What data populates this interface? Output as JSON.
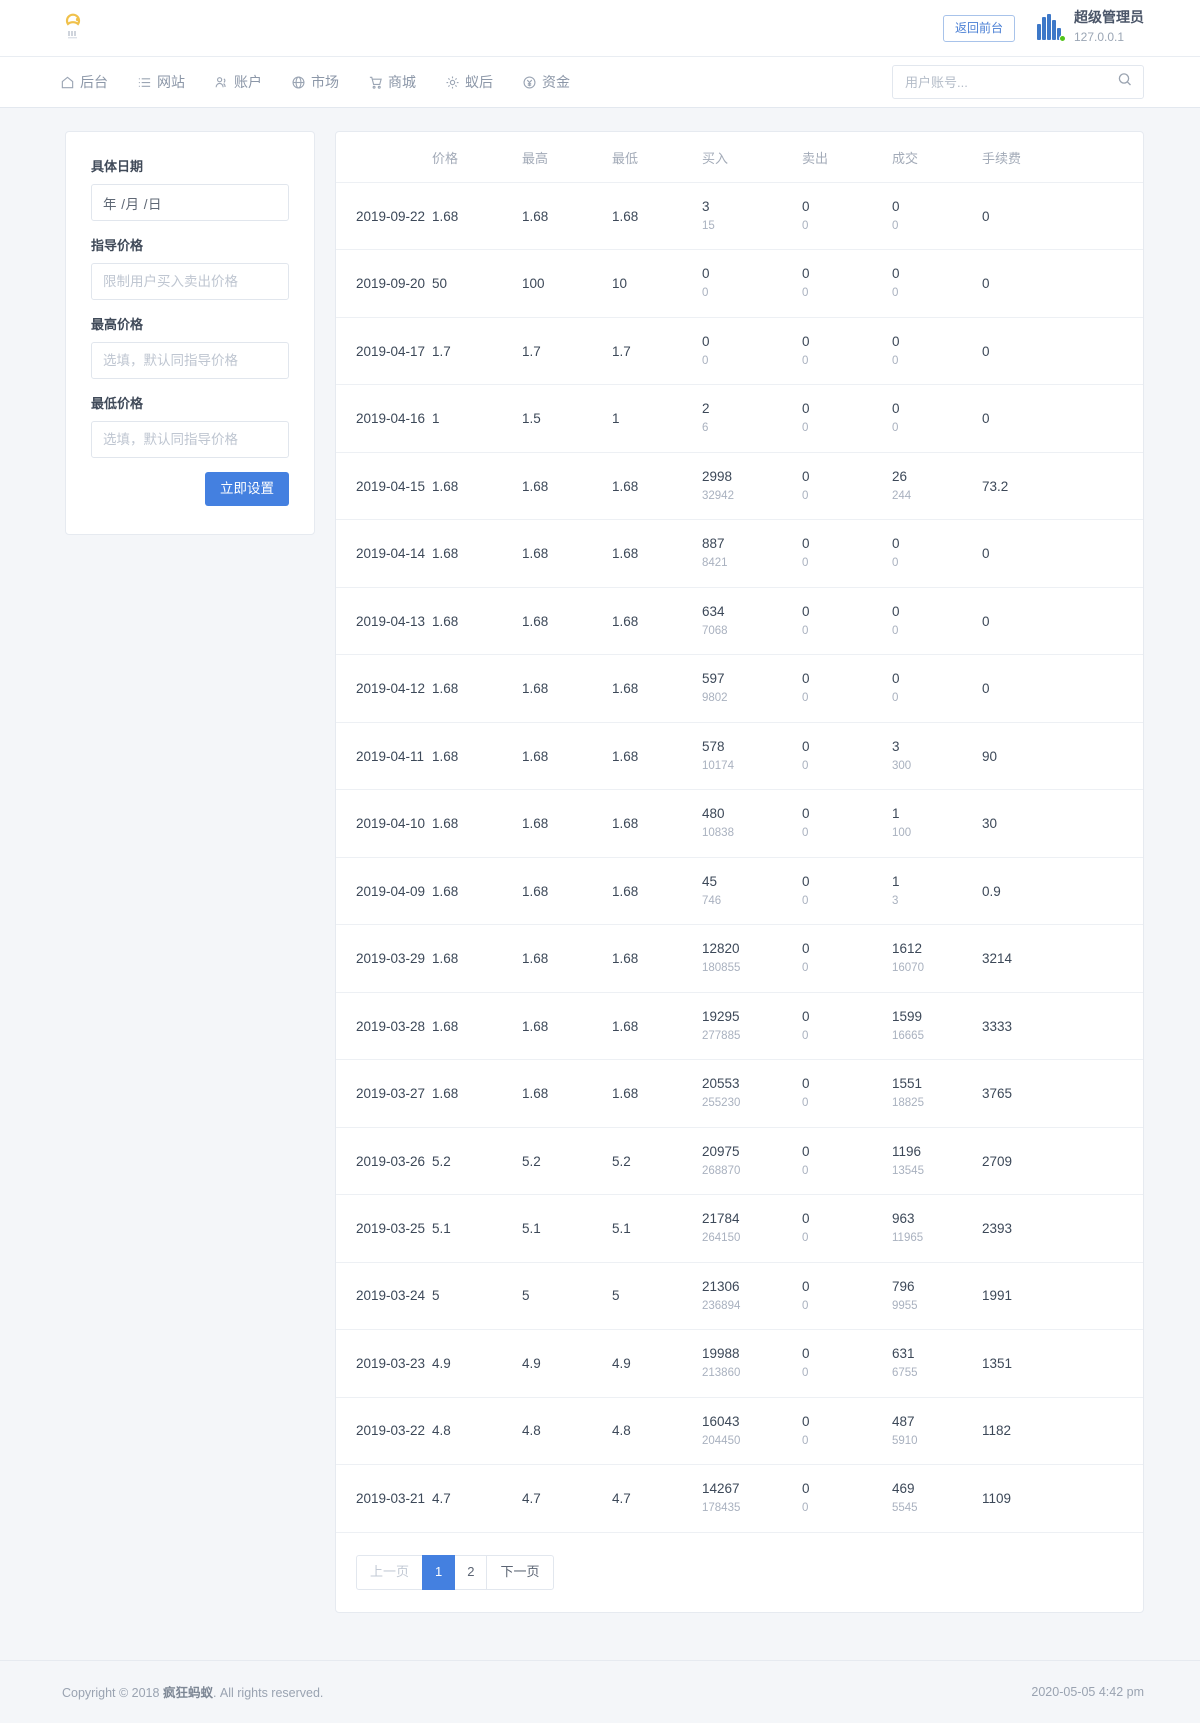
{
  "topbar": {
    "logo_icon": "ant-logo-icon",
    "return_front_label": "返回前台",
    "admin_name": "超级管理员",
    "admin_ip": "127.0.0.1"
  },
  "nav": {
    "items": [
      {
        "label": "后台",
        "icon": "home-icon"
      },
      {
        "label": "网站",
        "icon": "list-icon"
      },
      {
        "label": "账户",
        "icon": "users-icon"
      },
      {
        "label": "市场",
        "icon": "globe-icon"
      },
      {
        "label": "商城",
        "icon": "cart-icon"
      },
      {
        "label": "蚁后",
        "icon": "gear-icon"
      },
      {
        "label": "资金",
        "icon": "coin-icon"
      }
    ],
    "search_placeholder": "用户账号...",
    "search_value": "",
    "search_icon": "search-icon"
  },
  "form": {
    "fields": [
      {
        "label": "具体日期",
        "value": "年 /月 /日",
        "placeholder": "年 /月 /日",
        "name": "date-field"
      },
      {
        "label": "指导价格",
        "value": "",
        "placeholder": "限制用户买入卖出价格",
        "name": "guide-price-field"
      },
      {
        "label": "最高价格",
        "value": "",
        "placeholder": "选填，默认同指导价格",
        "name": "max-price-field"
      },
      {
        "label": "最低价格",
        "value": "",
        "placeholder": "选填，默认同指导价格",
        "name": "min-price-field"
      }
    ],
    "submit_label": "立即设置"
  },
  "table": {
    "columns": [
      "",
      "价格",
      "最高",
      "最低",
      "买入",
      "卖出",
      "成交",
      "手续费"
    ],
    "rows": [
      {
        "date": "2019-09-22",
        "price": "1.68",
        "high": "1.68",
        "low": "1.68",
        "buy": "3",
        "buy_sub": "15",
        "sell": "0",
        "sell_sub": "0",
        "deal": "0",
        "deal_sub": "0",
        "fee": "0"
      },
      {
        "date": "2019-09-20",
        "price": "50",
        "high": "100",
        "low": "10",
        "buy": "0",
        "buy_sub": "0",
        "sell": "0",
        "sell_sub": "0",
        "deal": "0",
        "deal_sub": "0",
        "fee": "0"
      },
      {
        "date": "2019-04-17",
        "price": "1.7",
        "high": "1.7",
        "low": "1.7",
        "buy": "0",
        "buy_sub": "0",
        "sell": "0",
        "sell_sub": "0",
        "deal": "0",
        "deal_sub": "0",
        "fee": "0"
      },
      {
        "date": "2019-04-16",
        "price": "1",
        "high": "1.5",
        "low": "1",
        "buy": "2",
        "buy_sub": "6",
        "sell": "0",
        "sell_sub": "0",
        "deal": "0",
        "deal_sub": "0",
        "fee": "0"
      },
      {
        "date": "2019-04-15",
        "price": "1.68",
        "high": "1.68",
        "low": "1.68",
        "buy": "2998",
        "buy_sub": "32942",
        "sell": "0",
        "sell_sub": "0",
        "deal": "26",
        "deal_sub": "244",
        "fee": "73.2"
      },
      {
        "date": "2019-04-14",
        "price": "1.68",
        "high": "1.68",
        "low": "1.68",
        "buy": "887",
        "buy_sub": "8421",
        "sell": "0",
        "sell_sub": "0",
        "deal": "0",
        "deal_sub": "0",
        "fee": "0"
      },
      {
        "date": "2019-04-13",
        "price": "1.68",
        "high": "1.68",
        "low": "1.68",
        "buy": "634",
        "buy_sub": "7068",
        "sell": "0",
        "sell_sub": "0",
        "deal": "0",
        "deal_sub": "0",
        "fee": "0"
      },
      {
        "date": "2019-04-12",
        "price": "1.68",
        "high": "1.68",
        "low": "1.68",
        "buy": "597",
        "buy_sub": "9802",
        "sell": "0",
        "sell_sub": "0",
        "deal": "0",
        "deal_sub": "0",
        "fee": "0"
      },
      {
        "date": "2019-04-11",
        "price": "1.68",
        "high": "1.68",
        "low": "1.68",
        "buy": "578",
        "buy_sub": "10174",
        "sell": "0",
        "sell_sub": "0",
        "deal": "3",
        "deal_sub": "300",
        "fee": "90"
      },
      {
        "date": "2019-04-10",
        "price": "1.68",
        "high": "1.68",
        "low": "1.68",
        "buy": "480",
        "buy_sub": "10838",
        "sell": "0",
        "sell_sub": "0",
        "deal": "1",
        "deal_sub": "100",
        "fee": "30"
      },
      {
        "date": "2019-04-09",
        "price": "1.68",
        "high": "1.68",
        "low": "1.68",
        "buy": "45",
        "buy_sub": "746",
        "sell": "0",
        "sell_sub": "0",
        "deal": "1",
        "deal_sub": "3",
        "fee": "0.9"
      },
      {
        "date": "2019-03-29",
        "price": "1.68",
        "high": "1.68",
        "low": "1.68",
        "buy": "12820",
        "buy_sub": "180855",
        "sell": "0",
        "sell_sub": "0",
        "deal": "1612",
        "deal_sub": "16070",
        "fee": "3214"
      },
      {
        "date": "2019-03-28",
        "price": "1.68",
        "high": "1.68",
        "low": "1.68",
        "buy": "19295",
        "buy_sub": "277885",
        "sell": "0",
        "sell_sub": "0",
        "deal": "1599",
        "deal_sub": "16665",
        "fee": "3333"
      },
      {
        "date": "2019-03-27",
        "price": "1.68",
        "high": "1.68",
        "low": "1.68",
        "buy": "20553",
        "buy_sub": "255230",
        "sell": "0",
        "sell_sub": "0",
        "deal": "1551",
        "deal_sub": "18825",
        "fee": "3765"
      },
      {
        "date": "2019-03-26",
        "price": "5.2",
        "high": "5.2",
        "low": "5.2",
        "buy": "20975",
        "buy_sub": "268870",
        "sell": "0",
        "sell_sub": "0",
        "deal": "1196",
        "deal_sub": "13545",
        "fee": "2709"
      },
      {
        "date": "2019-03-25",
        "price": "5.1",
        "high": "5.1",
        "low": "5.1",
        "buy": "21784",
        "buy_sub": "264150",
        "sell": "0",
        "sell_sub": "0",
        "deal": "963",
        "deal_sub": "11965",
        "fee": "2393"
      },
      {
        "date": "2019-03-24",
        "price": "5",
        "high": "5",
        "low": "5",
        "buy": "21306",
        "buy_sub": "236894",
        "sell": "0",
        "sell_sub": "0",
        "deal": "796",
        "deal_sub": "9955",
        "fee": "1991"
      },
      {
        "date": "2019-03-23",
        "price": "4.9",
        "high": "4.9",
        "low": "4.9",
        "buy": "19988",
        "buy_sub": "213860",
        "sell": "0",
        "sell_sub": "0",
        "deal": "631",
        "deal_sub": "6755",
        "fee": "1351"
      },
      {
        "date": "2019-03-22",
        "price": "4.8",
        "high": "4.8",
        "low": "4.8",
        "buy": "16043",
        "buy_sub": "204450",
        "sell": "0",
        "sell_sub": "0",
        "deal": "487",
        "deal_sub": "5910",
        "fee": "1182"
      },
      {
        "date": "2019-03-21",
        "price": "4.7",
        "high": "4.7",
        "low": "4.7",
        "buy": "14267",
        "buy_sub": "178435",
        "sell": "0",
        "sell_sub": "0",
        "deal": "469",
        "deal_sub": "5545",
        "fee": "1109"
      }
    ]
  },
  "pagination": {
    "prev_label": "上一页",
    "pages": [
      "1",
      "2"
    ],
    "active_page": "1",
    "next_label": "下一页"
  },
  "footer": {
    "copyright_prefix": "Copyright © 2018 ",
    "brand": "疯狂蚂蚁",
    "copyright_suffix": ". All rights reserved.",
    "datetime": "2020-05-05 4:42 pm"
  },
  "colors": {
    "accent": "#4480e0",
    "page_bg": "#f4f6f9",
    "text": "#3c4858",
    "muted": "#a9b1bf",
    "status_dot": "#52c41a"
  }
}
